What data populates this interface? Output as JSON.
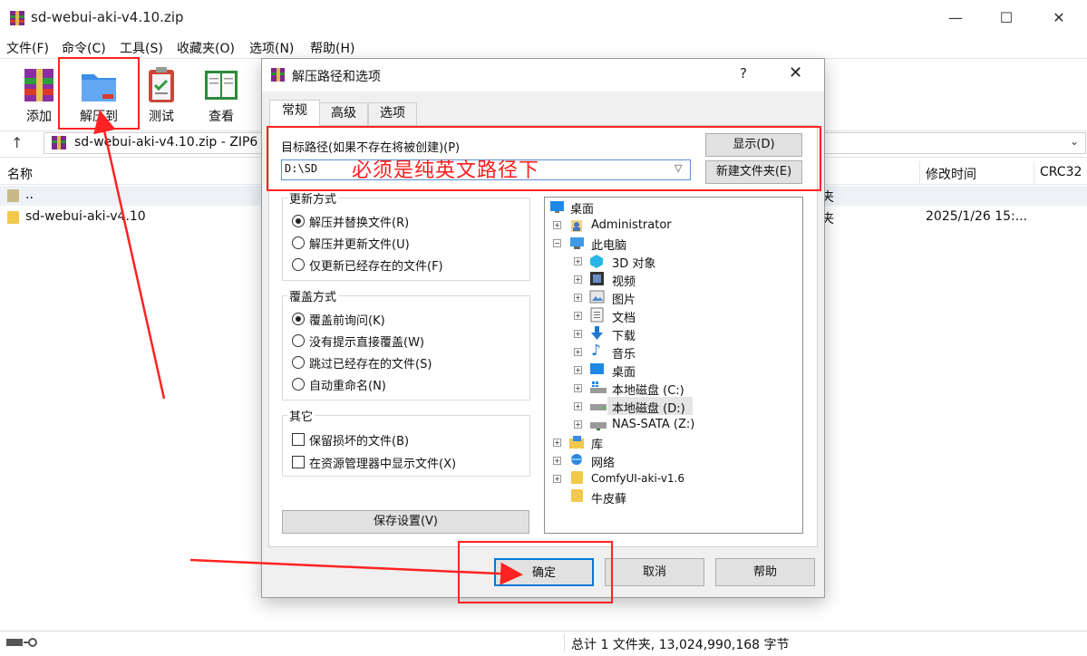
{
  "window": {
    "title": "sd-webui-aki-v4.10.zip",
    "controls": {
      "minimize": "—",
      "maximize": "☐",
      "close": "✕"
    }
  },
  "menu": [
    "文件(F)",
    "命令(C)",
    "工具(S)",
    "收藏夹(O)",
    "选项(N)",
    "帮助(H)"
  ],
  "toolbar": {
    "add": "添加",
    "extract_to": "解压到",
    "test": "测试",
    "view": "查看"
  },
  "address": {
    "text": "sd-webui-aki-v4.10.zip - ZIP6"
  },
  "columns": {
    "name": "名称",
    "modified": "修改时间",
    "crc": "CRC32"
  },
  "files": [
    {
      "name": "..",
      "modified": "",
      "type_cut": "夹"
    },
    {
      "name": "sd-webui-aki-v4.10",
      "modified": "2025/1/26 15:...",
      "type_cut": "夹"
    }
  ],
  "status": {
    "summary": "总计 1 文件夹, 13,024,990,168 字节"
  },
  "dialog": {
    "title": "解压路径和选项",
    "help": "?",
    "close": "✕",
    "tabs": [
      "常规",
      "高级",
      "选项"
    ],
    "dest_label": "目标路径(如果不存在将被创建)(P)",
    "dest_value": "D:\\SD",
    "show_button": "显示(D)",
    "new_folder_button": "新建文件夹(E)",
    "annotation": "必须是纯英文路径下",
    "update_mode": {
      "title": "更新方式",
      "options": [
        "解压并替换文件(R)",
        "解压并更新文件(U)",
        "仅更新已经存在的文件(F)"
      ],
      "selected": 0
    },
    "overwrite_mode": {
      "title": "覆盖方式",
      "options": [
        "覆盖前询问(K)",
        "没有提示直接覆盖(W)",
        "跳过已经存在的文件(S)",
        "自动重命名(N)"
      ],
      "selected": 0
    },
    "misc": {
      "title": "其它",
      "options": [
        "保留损坏的文件(B)",
        "在资源管理器中显示文件(X)"
      ]
    },
    "save_settings": "保存设置(V)",
    "tree": {
      "desktop": "桌面",
      "administrator": "Administrator",
      "this_pc": "此电脑",
      "pc_items": [
        "3D 对象",
        "视频",
        "图片",
        "文档",
        "下载",
        "音乐",
        "桌面",
        "本地磁盘 (C:)",
        "本地磁盘 (D:)",
        "NAS-SATA (Z:)"
      ],
      "library": "库",
      "network": "网络",
      "comfy": "ComfyUI-aki-v1.6",
      "niupixian": "牛皮藓"
    },
    "ok": "确定",
    "cancel": "取消",
    "help_button": "帮助"
  },
  "colors": {
    "accent": "#0078d7",
    "annotation_red": "#ff2222",
    "dialog_bg": "#f0f0f0"
  }
}
